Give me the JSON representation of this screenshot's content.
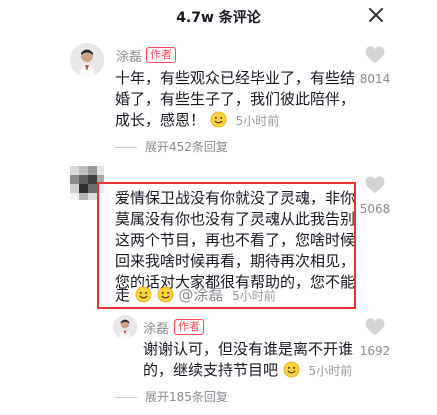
{
  "header": {
    "title": "4.7w 条评论"
  },
  "comments": [
    {
      "author": "涂磊",
      "tag": "作者",
      "lines": [
        "十年，有些观众已经毕业了，有些结",
        "婚了，有些生子了，我们彼此陪伴，",
        "成长，感恩！"
      ],
      "time": "5小时前",
      "likes": "8014",
      "expand": "展开452条回复"
    },
    {
      "lines": [
        "爱情保卫战没有你就没了灵魂，非你",
        "莫属没有你也没有了灵魂从此我告别",
        "这两个节目，再也不看了，您啥时候",
        "回来我啥时候再看，期待再次相见，",
        "您的话对大家都很有帮助的，您不能",
        "走"
      ],
      "mention": "@涂磊",
      "time": "5小时前",
      "likes": "5068"
    },
    {
      "author": "涂磊",
      "tag": "作者",
      "lines": [
        "谢谢认可，但没有谁是离不开谁",
        "的，继续支持节目吧"
      ],
      "time": "5小时前",
      "likes": "1692",
      "expand": "展开185条回复"
    }
  ],
  "colors": {
    "accent": "#ff4b57",
    "highlight": "#e83233",
    "muted": "#8a8b91"
  },
  "icons": [
    "close-icon",
    "heart-icon",
    "smile-emoji-icon",
    "avatar-icon"
  ]
}
